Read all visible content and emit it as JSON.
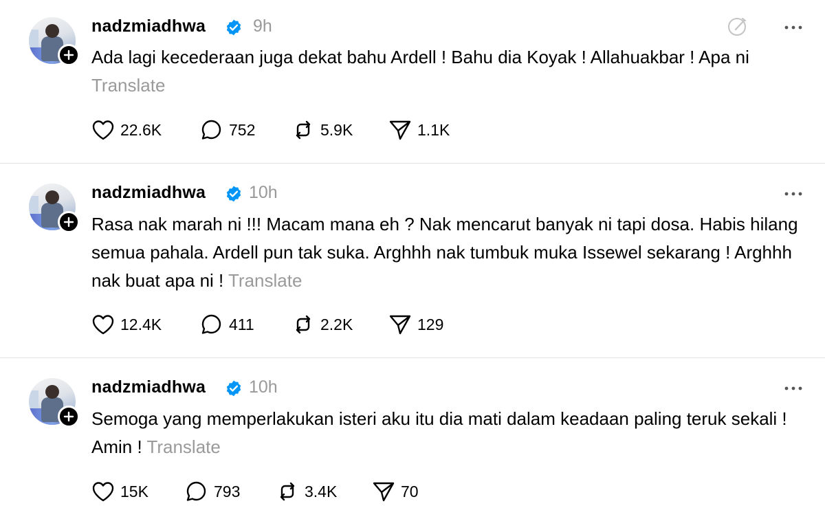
{
  "posts": [
    {
      "username": "nadzmiadhwa",
      "time": "9h",
      "text": "Ada lagi kecederaan juga dekat bahu Ardell ! Bahu dia Koyak ! Allahuakbar ! Apa ni",
      "translate": "Translate",
      "likes": "22.6K",
      "replies": "752",
      "reposts": "5.9K",
      "shares": "1.1K",
      "has_edit_icon": true
    },
    {
      "username": "nadzmiadhwa",
      "time": "10h",
      "text": "Rasa nak marah ni !!! Macam mana eh ? Nak mencarut banyak ni tapi dosa. Habis hilang semua pahala. Ardell pun tak suka. Arghhh nak tumbuk muka Issewel sekarang ! Arghhh nak buat apa ni !",
      "translate": "Translate",
      "likes": "12.4K",
      "replies": "411",
      "reposts": "2.2K",
      "shares": "129",
      "has_edit_icon": false
    },
    {
      "username": "nadzmiadhwa",
      "time": "10h",
      "text": "Semoga yang memperlakukan isteri aku itu dia mati dalam keadaan paling teruk sekali ! Amin !",
      "translate": "Translate",
      "likes": "15K",
      "replies": "793",
      "reposts": "3.4K",
      "shares": "70",
      "has_edit_icon": false
    }
  ],
  "icons": {
    "like": "heart-icon",
    "reply": "comment-icon",
    "repost": "repost-icon",
    "share": "send-icon",
    "more": "more-dots-icon",
    "verified": "verified-badge-icon",
    "follow": "plus-icon",
    "edit": "edit-icon"
  },
  "colors": {
    "verified_blue": "#0095f6",
    "muted_text": "#999999"
  }
}
